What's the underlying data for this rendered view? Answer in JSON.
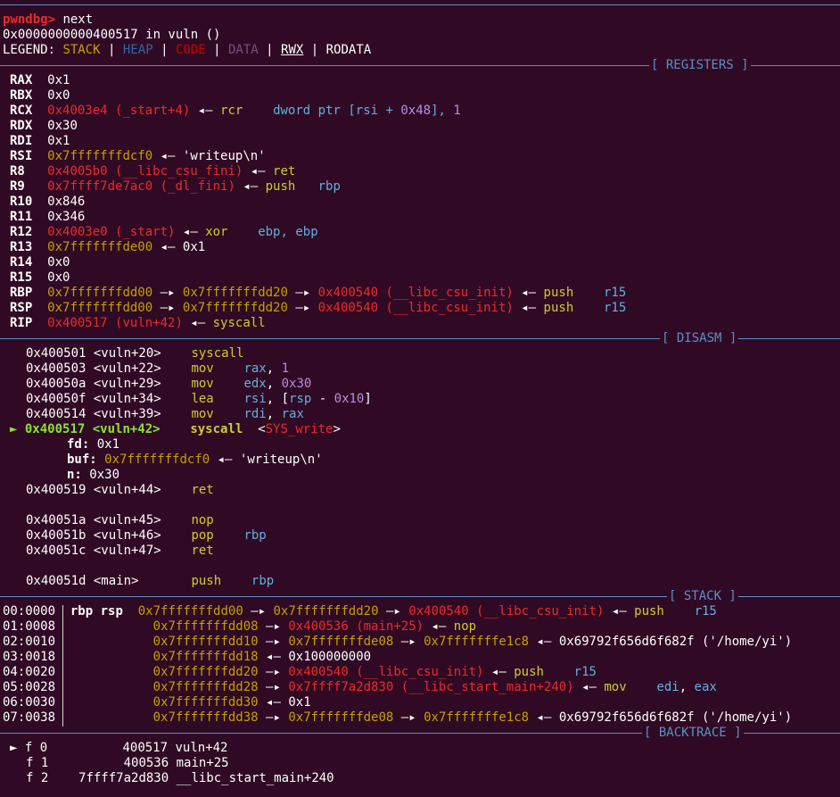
{
  "prompt": "pwndbg>",
  "command": "next",
  "location": "0x0000000000400517 in vuln ()",
  "legend": {
    "label": "LEGEND:",
    "stack": "STACK",
    "heap": "HEAP",
    "code": "CODE",
    "data": "DATA",
    "rwx": "RWX",
    "rodata": "RODATA",
    "sep": "|"
  },
  "headers": {
    "registers": "[ REGISTERS ]",
    "disasm": "[ DISASM ]",
    "stack": "[ STACK ]",
    "backtrace": "[ BACKTRACE ]"
  },
  "arrow": "◂—",
  "chain": "—▸",
  "marker": "►",
  "registers": {
    "rax": {
      "name": "RAX",
      "val": "0x1"
    },
    "rbx": {
      "name": "RBX",
      "val": "0x0"
    },
    "rcx": {
      "name": "RCX",
      "addr": "0x4003e4 (_start+4)",
      "ins": "rcr",
      "ops1": "dword ptr [rsi + ",
      "ops2": "0x48",
      "ops3": "], ",
      "ops4": "1"
    },
    "rdx": {
      "name": "RDX",
      "val": "0x30"
    },
    "rdi": {
      "name": "RDI",
      "val": "0x1"
    },
    "rsi": {
      "name": "RSI",
      "addr": "0x7fffffffdcf0",
      "str": "'writeup\\n'"
    },
    "r8": {
      "name": "R8",
      "addr": "0x4005b0 (__libc_csu_fini)",
      "ins": "ret"
    },
    "r9": {
      "name": "R9",
      "addr": "0x7ffff7de7ac0 (_dl_fini)",
      "ins": "push",
      "ops": "rbp"
    },
    "r10": {
      "name": "R10",
      "val": "0x846"
    },
    "r11": {
      "name": "R11",
      "val": "0x346"
    },
    "r12": {
      "name": "R12",
      "addr": "0x4003e0 (_start)",
      "ins": "xor",
      "ops1": "ebp",
      "ops2": ", ",
      "ops3": "ebp"
    },
    "r13": {
      "name": "R13",
      "addr": "0x7fffffffde00",
      "val": "0x1"
    },
    "r14": {
      "name": "R14",
      "val": "0x0"
    },
    "r15": {
      "name": "R15",
      "val": "0x0"
    },
    "rbp": {
      "name": "RBP",
      "a1": "0x7fffffffdd00",
      "a2": "0x7fffffffdd20",
      "a3": "0x400540 (__libc_csu_init)",
      "ins": "push",
      "ops": "r15"
    },
    "rsp": {
      "name": "RSP",
      "a1": "0x7fffffffdd00",
      "a2": "0x7fffffffdd20",
      "a3": "0x400540 (__libc_csu_init)",
      "ins": "push",
      "ops": "r15"
    },
    "rip": {
      "name": "RIP",
      "addr": "0x400517 (vuln+42)",
      "ins": "syscall"
    }
  },
  "disasm": {
    "l1": {
      "addr": "0x400501 <vuln+20>",
      "ins": "syscall"
    },
    "l2": {
      "addr": "0x400503 <vuln+22>",
      "ins": "mov",
      "op1": "rax",
      ",": ", ",
      "op2": "1"
    },
    "l3": {
      "addr": "0x40050a <vuln+29>",
      "ins": "mov",
      "op1": "edx",
      "op2": "0x30"
    },
    "l4": {
      "addr": "0x40050f <vuln+34>",
      "ins": "lea",
      "op1": "rsi",
      ",": ", [",
      "op2": "rsp",
      "mid": " - ",
      "op3": "0x10",
      "end": "]"
    },
    "l5": {
      "addr": "0x400514 <vuln+39>",
      "ins": "mov",
      "op1": "rdi",
      "op2": "rax"
    },
    "cur": {
      "addr": "0x400517 <vuln+42>",
      "ins": "syscall",
      "open": "<",
      "sys": "SYS_write",
      "close": ">"
    },
    "fd": {
      "label": "fd:",
      "val": "0x1"
    },
    "buf": {
      "label": "buf:",
      "addr": "0x7fffffffdcf0",
      "str": "'writeup\\n'"
    },
    "n": {
      "label": "n:",
      "val": "0x30"
    },
    "l6": {
      "addr": "0x400519 <vuln+44>",
      "ins": "ret"
    },
    "l7": {
      "addr": "0x40051a <vuln+45>",
      "ins": "nop"
    },
    "l8": {
      "addr": "0x40051b <vuln+46>",
      "ins": "pop",
      "op1": "rbp"
    },
    "l9": {
      "addr": "0x40051c <vuln+47>",
      "ins": "ret"
    },
    "l10": {
      "addr": "0x40051d <main>",
      "ins": "push",
      "op1": "rbp"
    }
  },
  "stack": {
    "s0": {
      "off": "00:0000",
      "regs": "rbp rsp",
      "a1": "0x7fffffffdd00",
      "a2": "0x7fffffffdd20",
      "a3": "0x400540 (__libc_csu_init)",
      "ins": "push",
      "ops": "r15"
    },
    "s1": {
      "off": "01:0008",
      "a1": "0x7fffffffdd08",
      "a2": "0x400536 (main+25)",
      "ins": "nop"
    },
    "s2": {
      "off": "02:0010",
      "a1": "0x7fffffffdd10",
      "a2": "0x7fffffffde08",
      "a3": "0x7fffffffe1c8",
      "val": "0x69792f656d6f682f ('/home/yi')"
    },
    "s3": {
      "off": "03:0018",
      "a1": "0x7fffffffdd18",
      "val": "0x100000000"
    },
    "s4": {
      "off": "04:0020",
      "a1": "0x7fffffffdd20",
      "a2": "0x400540 (__libc_csu_init)",
      "ins": "push",
      "ops": "r15"
    },
    "s5": {
      "off": "05:0028",
      "a1": "0x7fffffffdd28",
      "a2": "0x7ffff7a2d830 (__libc_start_main+240)",
      "ins": "mov",
      "op1": "edi",
      "sep": ", ",
      "op2": "eax"
    },
    "s6": {
      "off": "06:0030",
      "a1": "0x7fffffffdd30",
      "val": "0x1"
    },
    "s7": {
      "off": "07:0038",
      "a1": "0x7fffffffdd38",
      "a2": "0x7fffffffde08",
      "a3": "0x7fffffffe1c8",
      "val": "0x69792f656d6f682f ('/home/yi')"
    }
  },
  "backtrace": {
    "f0": {
      "frame": "f 0",
      "addr": "400517",
      "sym": "vuln+42"
    },
    "f1": {
      "frame": "f 1",
      "addr": "400536",
      "sym": "main+25"
    },
    "f2": {
      "frame": "f 2",
      "addr": "7ffff7a2d830",
      "sym": "__libc_start_main+240"
    }
  }
}
